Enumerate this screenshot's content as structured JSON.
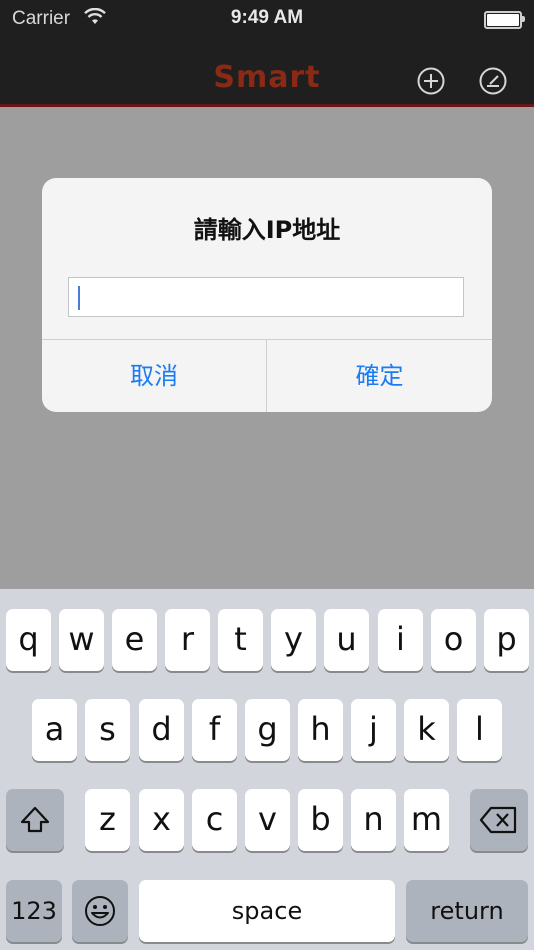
{
  "status_bar": {
    "carrier": "Carrier",
    "time": "9:49 AM"
  },
  "nav": {
    "logo": "Smart",
    "add_icon": "plus-circle-icon",
    "edit_icon": "edit-circle-icon"
  },
  "alert": {
    "title": "請輸入IP地址",
    "input_value": "",
    "cancel_label": "取消",
    "ok_label": "確定",
    "accent_color": "#1a7cf5"
  },
  "keyboard": {
    "row1": [
      "q",
      "w",
      "e",
      "r",
      "t",
      "y",
      "u",
      "i",
      "o",
      "p"
    ],
    "row2": [
      "a",
      "s",
      "d",
      "f",
      "g",
      "h",
      "j",
      "k",
      "l"
    ],
    "row3": [
      "z",
      "x",
      "c",
      "v",
      "b",
      "n",
      "m"
    ],
    "numbers_label": "123",
    "space_label": "space",
    "return_label": "return",
    "shift_icon": "shift-icon",
    "delete_icon": "backspace-icon",
    "emoji_icon": "emoji-icon"
  }
}
